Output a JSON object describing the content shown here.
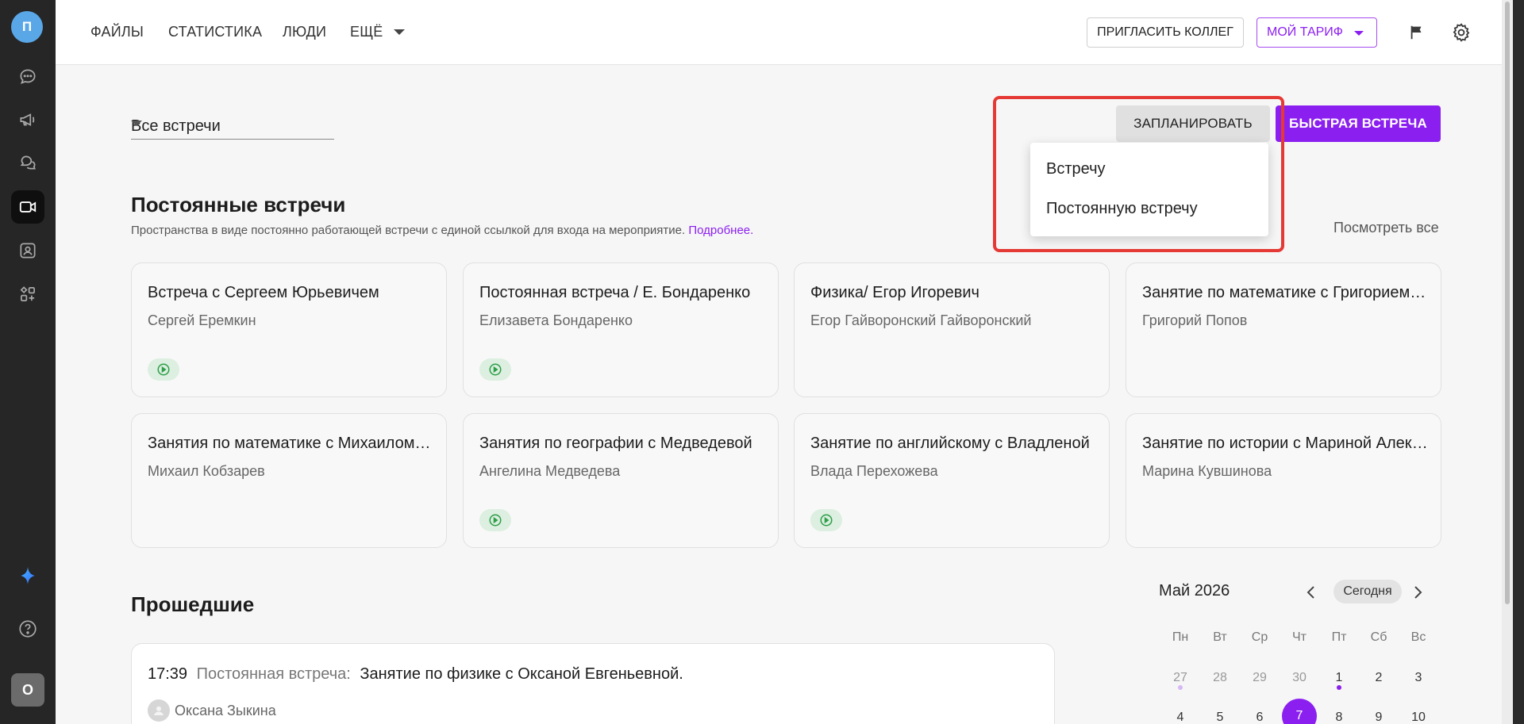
{
  "rail": {
    "top_avatar": "П",
    "bottom_avatar": "О",
    "icons": [
      "chat-icon",
      "megaphone-icon",
      "threads-icon",
      "video-icon",
      "contacts-icon",
      "apps-icon",
      "ai-sparkle-icon",
      "help-icon"
    ]
  },
  "nav": {
    "files": "ФАЙЛЫ",
    "stats": "СТАТИСТИКА",
    "people": "ЛЮДИ",
    "more": "ЕЩЁ",
    "invite": "ПРИГЛАСИТЬ КОЛЛЕГ",
    "tariff": "МОЙ ТАРИФ"
  },
  "filter": {
    "value": "Все встречи"
  },
  "actions": {
    "plan": "ЗАПЛАНИРОВАТЬ",
    "quick": "БЫСТРАЯ ВСТРЕЧА",
    "menu": [
      "Встречу",
      "Постоянную встречу"
    ]
  },
  "permanent": {
    "title": "Постоянные встречи",
    "subtitle": "Пространства в виде постоянно работающей встречи с единой ссылкой для входа на мероприятие.",
    "more_link": "Подробнее.",
    "view_all": "Посмотреть все",
    "cards": [
      {
        "title": "Встреча с Сергеем Юрьевичем",
        "owner": "Сергей Еремкин",
        "live": true
      },
      {
        "title": "Постоянная встреча / Е. Бондаренко",
        "owner": "Елизавета Бондаренко",
        "live": true
      },
      {
        "title": "Физика/ Егор Игоревич",
        "owner": "Егор Гайворонский Гайворонский",
        "live": false
      },
      {
        "title": "Занятие по математике с Григорием Поповым",
        "owner": "Григорий Попов",
        "live": false
      },
      {
        "title": "Занятия по математике с Михаилом Кобзаревым",
        "owner": "Михаил Кобзарев",
        "live": false
      },
      {
        "title": "Занятия по географии с Медведевой",
        "owner": "Ангелина Медведева",
        "live": true
      },
      {
        "title": "Занятие по английскому с Владленой",
        "owner": "Влада Перехожева",
        "live": true
      },
      {
        "title": "Занятие по истории с Мариной Алексеевной",
        "owner": "Марина Кувшинова",
        "live": false
      }
    ]
  },
  "past": {
    "title": "Прошедшие",
    "item": {
      "time": "17:39",
      "kind": "Постоянная встреча:",
      "name": "Занятие по физике с Оксаной Евгеньевной.",
      "person": "Оксана Зыкина"
    }
  },
  "calendar": {
    "month": "Май 2026",
    "today": "Сегодня",
    "dow": [
      "Пн",
      "Вт",
      "Ср",
      "Чт",
      "Пт",
      "Сб",
      "Вс"
    ],
    "week1": [
      "27",
      "28",
      "29",
      "30",
      "1",
      "2",
      "3"
    ],
    "week2": [
      "4",
      "5",
      "6",
      "7",
      "8",
      "9",
      "10"
    ],
    "selected": "7",
    "accent": "#8b1ff0"
  }
}
